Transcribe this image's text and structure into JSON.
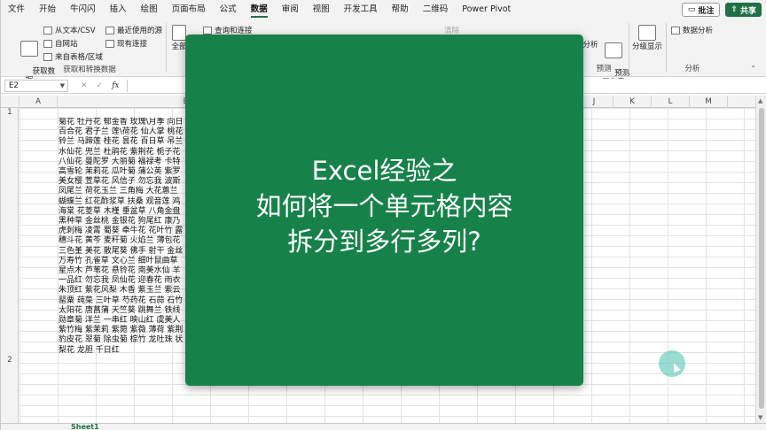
{
  "menu": {
    "tabs": [
      "文件",
      "开始",
      "牛闪闪",
      "插入",
      "绘图",
      "页面布局",
      "公式",
      "数据",
      "审阅",
      "视图",
      "开发工具",
      "帮助",
      "二维码",
      "Power Pivot"
    ],
    "active": "数据",
    "comment_label": "批注",
    "share_label": "共享"
  },
  "ribbon": {
    "get_data_label": "获取数\n据",
    "from_text_csv": "从文本/CSV",
    "from_web": "自网站",
    "from_table": "来自表格/区域",
    "recent_sources": "最近使用的源",
    "existing_connections": "现有连接",
    "group_get_transform": "获取和转换数据",
    "refresh_all": "全部",
    "queries_connections": "查询和连接",
    "clear_label": "清除",
    "whatif_label": "分析",
    "forecast_sheet": "预测\n工作表",
    "group_forecast": "预测",
    "outline_label": "分级显示",
    "data_analysis": "数据分析",
    "group_analysis": "分析"
  },
  "formula_bar": {
    "name_box": "E2",
    "fx_label": "fx",
    "cancel": "✕",
    "enter": "✓"
  },
  "columns": [
    "A",
    "B",
    "J",
    "K",
    "L",
    "M"
  ],
  "rows": [
    "1",
    "2"
  ],
  "cell_B1_lines": [
    "菊花 牡丹花 郁金香 玫瑰\\月季 向日",
    "百合花 君子兰 莲\\荷花 仙人掌 桃花",
    "铃兰 马蹄莲 桂花 昙花 百日草 吊兰",
    "水仙花 兜兰 杜鹃花 紫荆花 栀子花",
    "八仙花 曼陀罗 大丽菊 福禄考 卡特",
    "高雪轮 茉莉花 瓜叶菊 蒲公英 紫罗",
    "美女樱 萱草花 风信子 勿忘我 波斯",
    "凤尾兰 荷花玉兰 三角梅 大花蕙兰",
    "蝴蝶兰 红花酢浆草 扶桑 观音莲 鸡",
    "海棠 花菱草 木槿 垂盆草 八角金盘",
    "黑种草 金丝桃 金银花 狗尾红 康乃",
    "虎刺梅 凌霄 蜀葵 牵牛花 花叶竹 露",
    "穗斗花 黄芩 麦秆菊 火焰兰 薄包花",
    "三色堇 美花 散尾葵 佛手 射干 金丝",
    "万寿竹 孔雀草 文心兰 细叶鼠曲草",
    "星点木 芦苇花 悬铃花 南美水仙 羊",
    "一品红 勿忘我 凤仙花 迎春花 雨衣",
    "朱顶红 紫花风梨 木香 紫玉兰 紫云",
    "罂粟 莼菜 三叶草 芍药花 石蒜 石竹",
    "太阳花 唐菖蒲 天竺葵 跳舞兰 铁线",
    "勋章菊 洋兰 一串红 映山红 虞美人",
    "紫竹梅 紫茉莉 紫菀 紫薇 薄荷 紫荆",
    "豹皮花 翠菊 除虫菊 棕竹 龙吐珠 状",
    "梨花 龙胆 千日红"
  ],
  "sheet_tab": "Sheet1",
  "card": {
    "line1": "Excel经验之",
    "line2": "如何将一个单元格内容",
    "line3": "拆分到多行多列?",
    "background": "#16824a"
  },
  "accent": "#1e7145"
}
